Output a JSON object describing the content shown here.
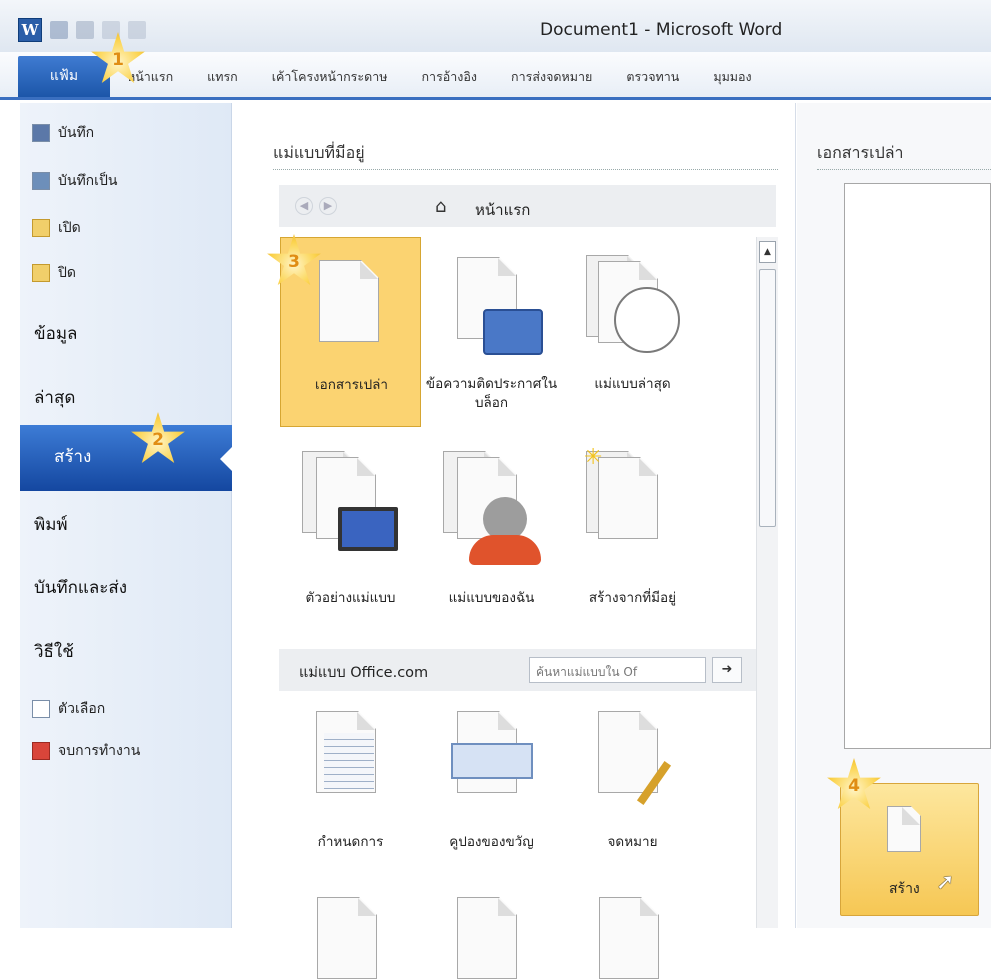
{
  "window": {
    "title": "Document1 - Microsoft Word",
    "app_icon": "W"
  },
  "ribbon": {
    "file_tab": "แฟ้ม",
    "tabs": [
      "หน้าแรก",
      "แทรก",
      "เค้าโครงหน้ากระดาษ",
      "การอ้างอิง",
      "การส่งจดหมาย",
      "ตรวจทาน",
      "มุมมอง"
    ]
  },
  "sidebar": {
    "items": [
      {
        "label": "บันทึก",
        "icon": "save-icon"
      },
      {
        "label": "บันทึกเป็น",
        "icon": "save-as-icon"
      },
      {
        "label": "เปิด",
        "icon": "open-folder-icon"
      },
      {
        "label": "ปิด",
        "icon": "close-folder-icon"
      }
    ],
    "sections": [
      "ข้อมูล",
      "ล่าสุด",
      "สร้าง",
      "พิมพ์",
      "บันทึกและส่ง",
      "วิธีใช้"
    ],
    "active": "สร้าง",
    "footer": [
      {
        "label": "ตัวเลือก",
        "icon": "options-icon"
      },
      {
        "label": "จบการทำงาน",
        "icon": "exit-icon"
      }
    ]
  },
  "available": {
    "header": "แม่แบบที่มีอยู่",
    "nav_label": "หน้าแรก",
    "templates": [
      {
        "label": "เอกสารเปล่า",
        "selected": true
      },
      {
        "label": "ข้อความติดประกาศในบล็อก"
      },
      {
        "label": "แม่แบบล่าสุด"
      },
      {
        "label": "ตัวอย่างแม่แบบ"
      },
      {
        "label": "แม่แบบของฉัน"
      },
      {
        "label": "สร้างจากที่มีอยู่"
      }
    ],
    "office_label": "แม่แบบ Office.com",
    "search_placeholder": "ค้นหาแม่แบบใน Of",
    "office_templates": [
      "กำหนดการ",
      "คูปองของขวัญ",
      "จดหมาย"
    ]
  },
  "preview": {
    "header": "เอกสารเปล่า",
    "create_label": "สร้าง"
  },
  "callouts": [
    "1",
    "2",
    "3",
    "4"
  ],
  "colors": {
    "accent": "#1c56a9",
    "selected": "#fbd371",
    "star": "#fbd34d"
  }
}
